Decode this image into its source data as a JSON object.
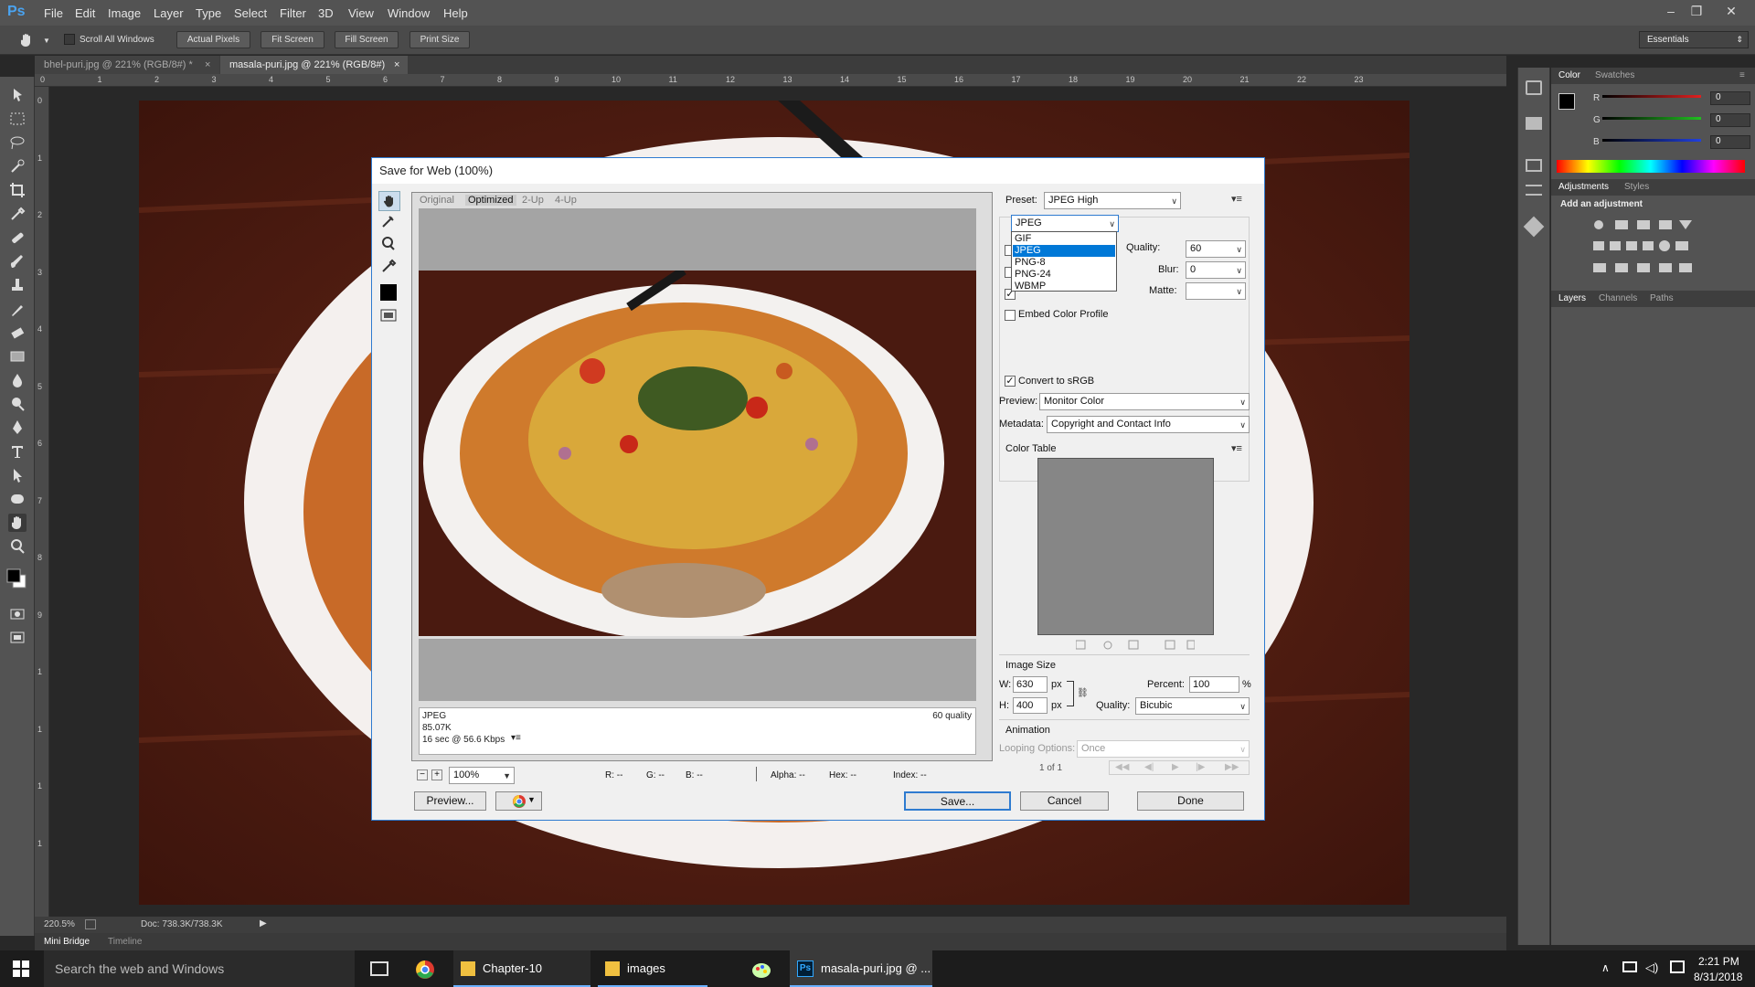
{
  "app": {
    "logo": "Ps",
    "menu": [
      "File",
      "Edit",
      "Image",
      "Layer",
      "Type",
      "Select",
      "Filter",
      "3D",
      "View",
      "Window",
      "Help"
    ],
    "window_controls": [
      "–",
      "❐",
      "✕"
    ],
    "workspace": "Essentials",
    "accent": "#4aa3f0"
  },
  "options_bar": {
    "scroll_all_label": "Scroll All Windows",
    "actual_pixels": "Actual Pixels",
    "fit_screen": "Fit Screen",
    "fill_screen": "Fill Screen",
    "print_size": "Print Size"
  },
  "tabs": [
    {
      "label": "bhel-puri.jpg @ 221% (RGB/8#) *",
      "close": "×"
    },
    {
      "label": "masala-puri.jpg @ 221% (RGB/8#)",
      "close": "×"
    }
  ],
  "ruler_h": [
    "0",
    "1",
    "2",
    "3",
    "4",
    "5",
    "6",
    "7",
    "8",
    "9",
    "10",
    "11",
    "12",
    "13",
    "14",
    "15",
    "16",
    "17",
    "18",
    "19",
    "20",
    "21",
    "22",
    "23"
  ],
  "ruler_v": [
    "0",
    "1",
    "2",
    "3",
    "4",
    "5",
    "6",
    "7",
    "8",
    "9",
    "1",
    "1",
    "1",
    "1"
  ],
  "status": {
    "zoom": "220.5%",
    "doc": "Doc: 738.3K/738.3K"
  },
  "bottom_tabs": [
    "Mini Bridge",
    "Timeline"
  ],
  "right_panel": {
    "color_tabs": [
      "Color",
      "Swatches"
    ],
    "sliders": [
      {
        "label": "R",
        "value": "0",
        "color": "#e02020"
      },
      {
        "label": "G",
        "value": "0",
        "color": "#20c020"
      },
      {
        "label": "B",
        "value": "0",
        "color": "#2040e0"
      }
    ],
    "adj_tabs": [
      "Adjustments",
      "Styles"
    ],
    "add_adjustment": "Add an adjustment",
    "layer_tabs": [
      "Layers",
      "Channels",
      "Paths"
    ]
  },
  "dialog": {
    "title": "Save for Web (100%)",
    "view_tabs": [
      "Original",
      "Optimized",
      "2-Up",
      "4-Up"
    ],
    "info": {
      "format": "JPEG",
      "size": "85.07K",
      "time": "16 sec @ 56.6 Kbps",
      "quality": "60 quality"
    },
    "preset_label": "Preset:",
    "preset_value": "JPEG High",
    "format_value": "JPEG",
    "format_options": [
      "GIF",
      "JPEG",
      "PNG-8",
      "PNG-24",
      "WBMP"
    ],
    "format_selected": "JPEG",
    "quality_label": "Quality:",
    "quality_value": "60",
    "blur_label": "Blur:",
    "blur_value": "0",
    "matte_label": "Matte:",
    "matte_value": "",
    "embed_color_profile": "Embed Color Profile",
    "convert_srgb": "Convert to sRGB",
    "check_mark": "✓",
    "preview_label": "Preview:",
    "preview_value": "Monitor Color",
    "metadata_label": "Metadata:",
    "metadata_value": "Copyright and Contact Info",
    "color_table": "Color Table",
    "image_size": {
      "title": "Image Size",
      "w_label": "W:",
      "w_value": "630",
      "h_label": "H:",
      "h_value": "400",
      "unit": "px",
      "percent_label": "Percent:",
      "percent_value": "100",
      "percent_unit": "%",
      "quality_label": "Quality:",
      "quality_value": "Bicubic"
    },
    "animation": {
      "title": "Animation",
      "looping_label": "Looping Options:",
      "looping_value": "Once",
      "frame": "1 of 1"
    },
    "zoom_value": "100%",
    "readouts": {
      "r": "R: --",
      "g": "G: --",
      "b": "B: --",
      "alpha": "Alpha: --",
      "hex": "Hex: --",
      "index": "Index: --"
    },
    "buttons": {
      "preview": "Preview...",
      "save": "Save...",
      "cancel": "Cancel",
      "done": "Done"
    }
  },
  "taskbar": {
    "search": "Search the web and Windows",
    "apps": [
      {
        "label": "Chapter-10"
      },
      {
        "label": "images"
      },
      {
        "label": "masala-puri.jpg @ ..."
      }
    ],
    "time": "2:21 PM",
    "date": "8/31/2018"
  }
}
